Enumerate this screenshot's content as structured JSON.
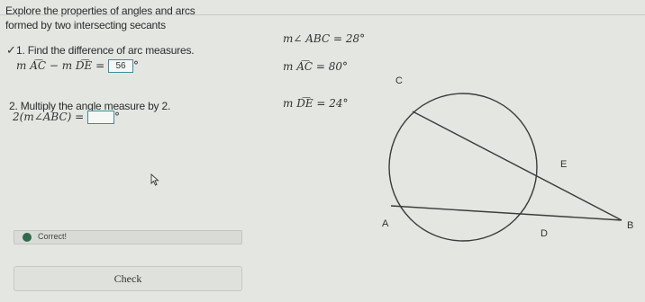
{
  "intro": {
    "line1": "Explore the properties of angles and arcs",
    "line2": "formed by two intersecting secants"
  },
  "given": {
    "angle_abc": "m∠ ABC = 28°",
    "arc_ac": "m A͡C = 80°",
    "arc_de": "m D͡E = 24°"
  },
  "questions": {
    "q1_text": "1. Find the difference of arc measures.",
    "q1_expr": "m A͡C − m D͡E =",
    "q1_answer": "56",
    "q2_text": "2. Multiply the angle measure by 2.",
    "q2_expr": "2(m∠ABC) =",
    "q2_answer": "",
    "unit": "°"
  },
  "feedback": {
    "text": "Correct!"
  },
  "check_button": {
    "label": "Check"
  },
  "figure": {
    "labels": {
      "c": "C",
      "e": "E",
      "a": "A",
      "d": "D",
      "b": "B"
    }
  },
  "icons": [
    "checkmark-icon",
    "correct-icon",
    "mouse-cursor-icon"
  ]
}
